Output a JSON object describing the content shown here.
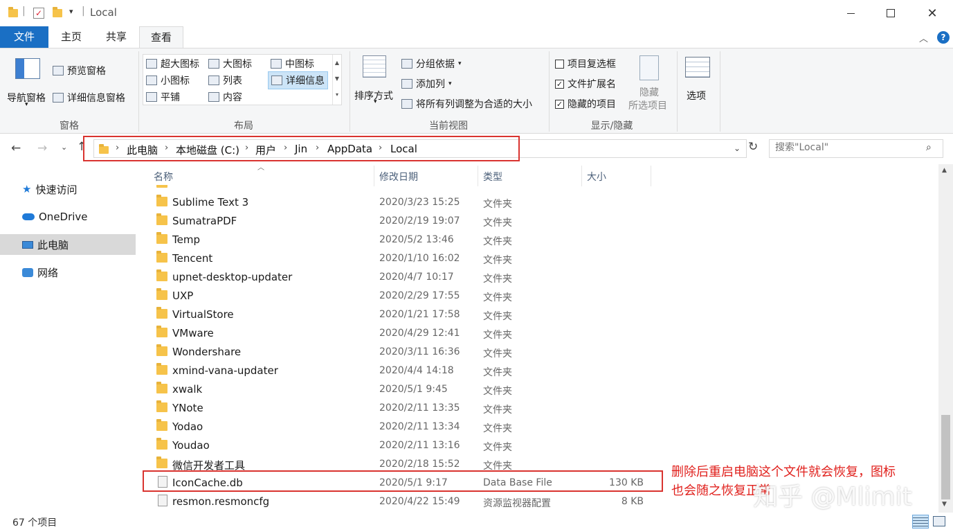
{
  "window": {
    "title": "Local"
  },
  "ribbon_tabs": [
    "文件",
    "主页",
    "共享",
    "查看"
  ],
  "ribbon": {
    "panes": {
      "label": "窗格",
      "nav_pane": "导航窗格",
      "preview_pane": "预览窗格",
      "details_pane": "详细信息窗格"
    },
    "layout": {
      "label": "布局",
      "items": [
        "超大图标",
        "大图标",
        "中图标",
        "小图标",
        "列表",
        "详细信息",
        "平铺",
        "内容"
      ],
      "selected": "详细信息"
    },
    "current_view": {
      "label": "当前视图",
      "sort_by": "排序方式",
      "group_by": "分组依据",
      "add_column": "添加列",
      "fit_columns": "将所有列调整为合适的大小"
    },
    "show_hide": {
      "label": "显示/隐藏",
      "item_checkboxes": "项目复选框",
      "item_checkboxes_checked": false,
      "file_extensions": "文件扩展名",
      "file_extensions_checked": true,
      "hidden_items": "隐藏的项目",
      "hidden_items_checked": true,
      "hide_selected_line1": "隐藏",
      "hide_selected_line2": "所选项目"
    },
    "options": "选项"
  },
  "address": {
    "crumbs": [
      "此电脑",
      "本地磁盘 (C:)",
      "用户",
      "Jin",
      "AppData",
      "Local"
    ]
  },
  "search": {
    "placeholder": "搜索\"Local\""
  },
  "nav_pane": {
    "items": [
      {
        "label": "快速访问",
        "icon": "star-icon"
      },
      {
        "label": "OneDrive",
        "icon": "cloud-icon"
      },
      {
        "label": "此电脑",
        "icon": "computer-icon",
        "selected": true
      },
      {
        "label": "网络",
        "icon": "network-icon"
      }
    ]
  },
  "columns": {
    "name": "名称",
    "date": "修改日期",
    "type": "类型",
    "size": "大小"
  },
  "files": [
    {
      "name": "Sublime Text 3",
      "date": "2020/3/23 15:25",
      "type": "文件夹",
      "size": ""
    },
    {
      "name": "SumatraPDF",
      "date": "2020/2/19 19:07",
      "type": "文件夹",
      "size": ""
    },
    {
      "name": "Temp",
      "date": "2020/5/2 13:46",
      "type": "文件夹",
      "size": ""
    },
    {
      "name": "Tencent",
      "date": "2020/1/10 16:02",
      "type": "文件夹",
      "size": ""
    },
    {
      "name": "upnet-desktop-updater",
      "date": "2020/4/7 10:17",
      "type": "文件夹",
      "size": ""
    },
    {
      "name": "UXP",
      "date": "2020/2/29 17:55",
      "type": "文件夹",
      "size": ""
    },
    {
      "name": "VirtualStore",
      "date": "2020/1/21 17:58",
      "type": "文件夹",
      "size": ""
    },
    {
      "name": "VMware",
      "date": "2020/4/29 12:41",
      "type": "文件夹",
      "size": ""
    },
    {
      "name": "Wondershare",
      "date": "2020/3/11 16:36",
      "type": "文件夹",
      "size": ""
    },
    {
      "name": "xmind-vana-updater",
      "date": "2020/4/4 14:18",
      "type": "文件夹",
      "size": ""
    },
    {
      "name": "xwalk",
      "date": "2020/5/1 9:45",
      "type": "文件夹",
      "size": ""
    },
    {
      "name": "YNote",
      "date": "2020/2/11 13:35",
      "type": "文件夹",
      "size": ""
    },
    {
      "name": "Yodao",
      "date": "2020/2/11 13:34",
      "type": "文件夹",
      "size": ""
    },
    {
      "name": "Youdao",
      "date": "2020/2/11 13:16",
      "type": "文件夹",
      "size": ""
    },
    {
      "name": "微信开发者工具",
      "date": "2020/2/18 15:52",
      "type": "文件夹",
      "size": ""
    },
    {
      "name": "IconCache.db",
      "date": "2020/5/1 9:17",
      "type": "Data Base File",
      "size": "130 KB"
    },
    {
      "name": "resmon.resmoncfg",
      "date": "2020/4/22 15:49",
      "type": "资源监视器配置",
      "size": "8 KB"
    }
  ],
  "status": {
    "count": "67 个项目"
  },
  "annotation": {
    "line1": "删除后重启电脑这个文件就会恢复，图标",
    "line2": "也会随之恢复正常"
  },
  "watermark": "知乎 @Mlimit",
  "colors": {
    "file_tab": "#1a6fc4",
    "annotation_red": "#e0201c",
    "folder_yellow": "#f6c34a"
  }
}
